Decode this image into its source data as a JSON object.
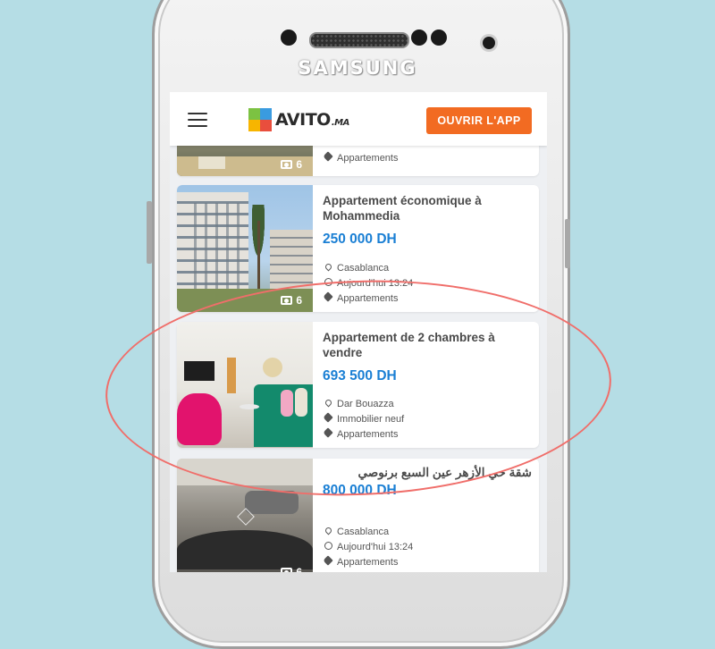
{
  "device": {
    "brand": "SAMSUNG"
  },
  "header": {
    "logo_text": "AVITO",
    "logo_suffix": ".MA",
    "cta_label": "OUVRIR L'APP"
  },
  "listings": [
    {
      "photo_count": "6",
      "category": "Appartements"
    },
    {
      "title": "Appartement économique à Mohammedia",
      "price": "250 000 DH",
      "location": "Casablanca",
      "time": "Aujourd'hui 13:24",
      "category": "Appartements",
      "photo_count": "6"
    },
    {
      "title": "Appartement de 2 chambres à vendre",
      "price": "693 500 DH",
      "location": "Dar Bouazza",
      "type": "Immobilier neuf",
      "category": "Appartements"
    },
    {
      "title": "شقة حي الأزهر عين السبع برنوصي",
      "price": "800 000 DH",
      "location": "Casablanca",
      "time": "Aujourd'hui 13:24",
      "category": "Appartements",
      "photo_count": "6"
    }
  ],
  "colors": {
    "background": "#b5dde5",
    "accent_orange": "#f26b22",
    "price_blue": "#1a7fd4",
    "annotation_red": "#f06e6a"
  },
  "icons": [
    "menu-icon",
    "camera-icon",
    "location-pin-icon",
    "clock-icon",
    "tag-icon"
  ]
}
